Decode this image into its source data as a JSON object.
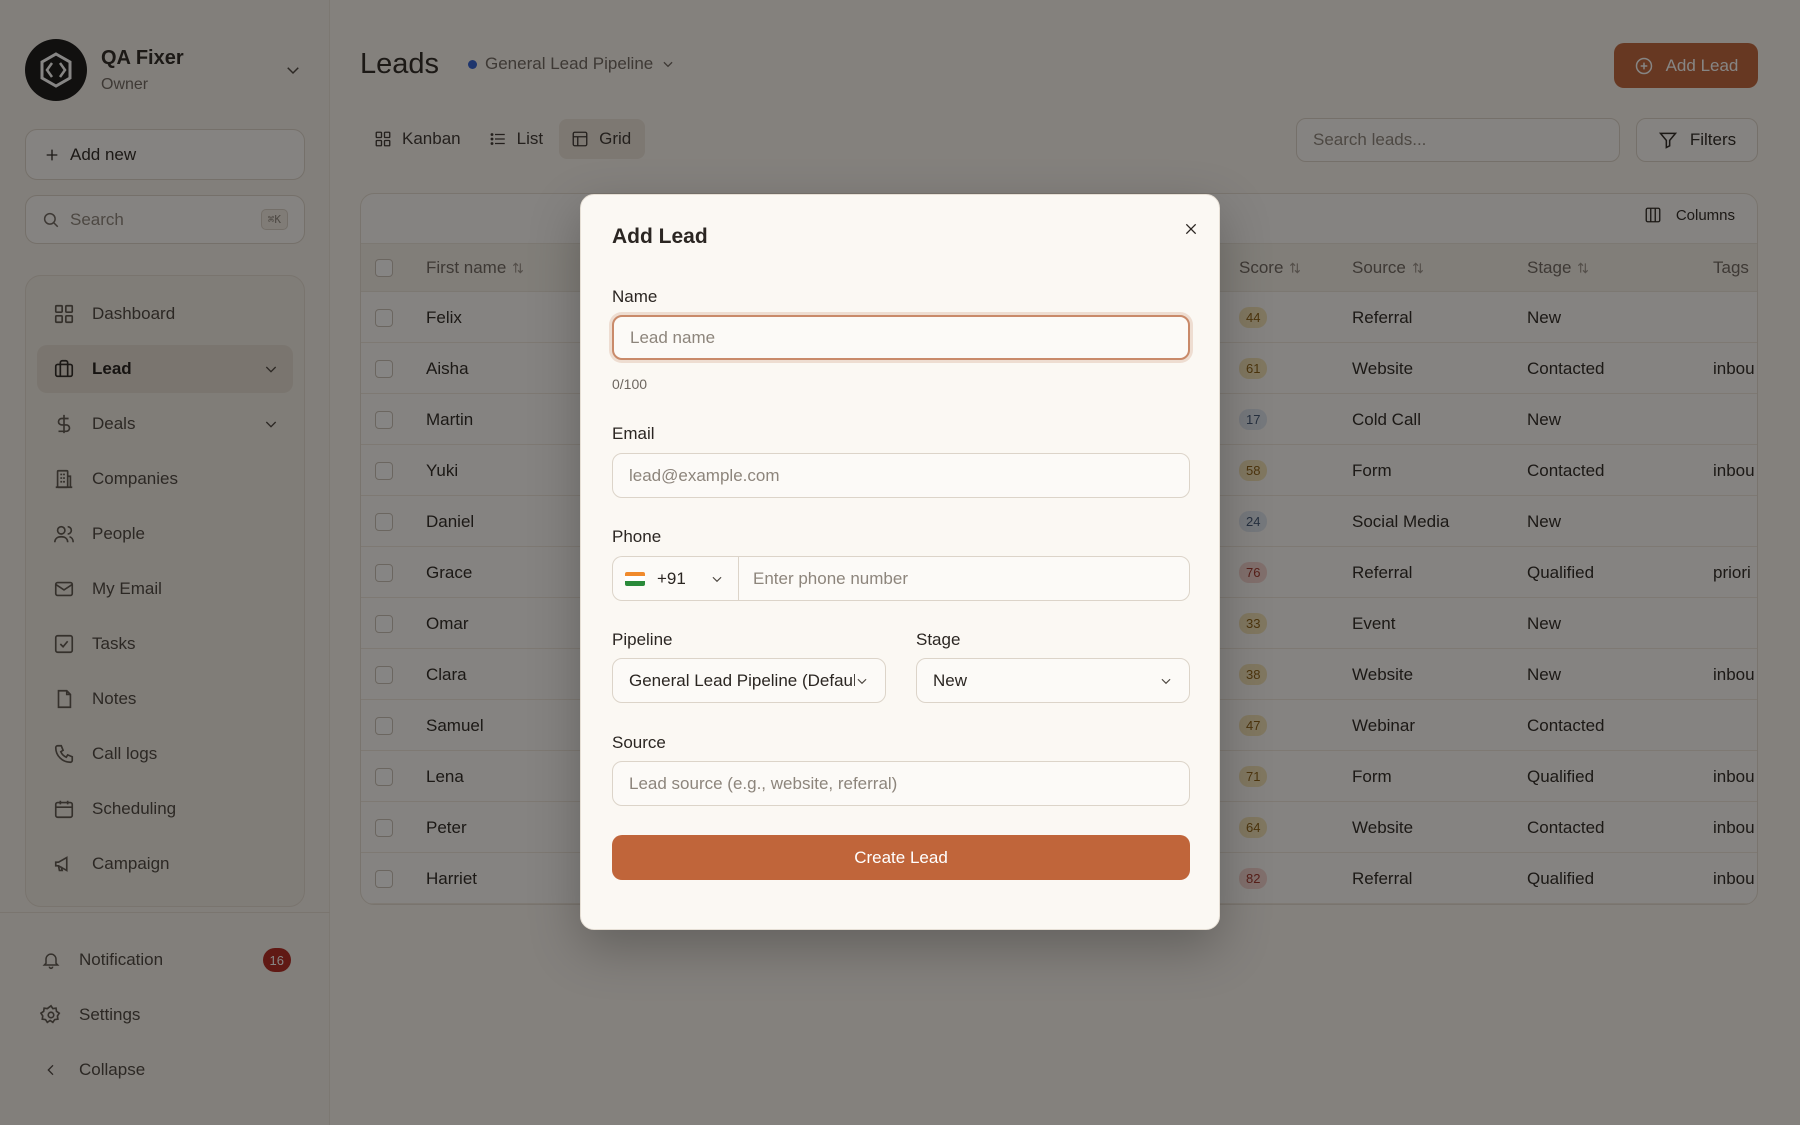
{
  "org": {
    "name": "QA Fixer",
    "role": "Owner"
  },
  "sidebar": {
    "add_new_label": "Add new",
    "search_label": "Search",
    "search_shortcut": "⌘K",
    "items": [
      {
        "label": "Dashboard",
        "icon": "dashboard-icon"
      },
      {
        "label": "Lead",
        "icon": "briefcase-icon",
        "active": true
      },
      {
        "label": "Deals",
        "icon": "dollar-icon"
      },
      {
        "label": "Companies",
        "icon": "building-icon"
      },
      {
        "label": "People",
        "icon": "people-icon"
      },
      {
        "label": "My Email",
        "icon": "mail-icon"
      },
      {
        "label": "Tasks",
        "icon": "task-icon"
      },
      {
        "label": "Notes",
        "icon": "note-icon"
      },
      {
        "label": "Call logs",
        "icon": "phone-icon"
      },
      {
        "label": "Scheduling",
        "icon": "calendar-icon"
      },
      {
        "label": "Campaign",
        "icon": "megaphone-icon"
      }
    ],
    "footer": {
      "notification_label": "Notification",
      "notification_count": "16",
      "settings_label": "Settings",
      "collapse_label": "Collapse"
    }
  },
  "header": {
    "title": "Leads",
    "pipeline": "General Lead Pipeline",
    "add_lead_label": "Add Lead"
  },
  "view_tabs": [
    {
      "label": "Kanban"
    },
    {
      "label": "List"
    },
    {
      "label": "Grid",
      "active": true
    }
  ],
  "toolbar": {
    "search_placeholder": "Search leads...",
    "filters_label": "Filters",
    "columns_label": "Columns"
  },
  "table": {
    "headers": {
      "first_name": "First name",
      "score": "Score",
      "source": "Source",
      "stage": "Stage",
      "tags": "Tags"
    },
    "rows": [
      {
        "first_name": "Felix",
        "score": "44",
        "score_tone": "y",
        "source": "Referral",
        "stage": "New",
        "tags": ""
      },
      {
        "first_name": "Aisha",
        "score": "61",
        "score_tone": "y",
        "source": "Website",
        "stage": "Contacted",
        "tags": "inbou"
      },
      {
        "first_name": "Martin",
        "score": "17",
        "score_tone": "b",
        "source": "Cold Call",
        "stage": "New",
        "tags": ""
      },
      {
        "first_name": "Yuki",
        "score": "58",
        "score_tone": "y",
        "source": "Form",
        "stage": "Contacted",
        "tags": "inbou"
      },
      {
        "first_name": "Daniel",
        "score": "24",
        "score_tone": "b",
        "source": "Social Media",
        "stage": "New",
        "tags": ""
      },
      {
        "first_name": "Grace",
        "score": "76",
        "score_tone": "r",
        "source": "Referral",
        "stage": "Qualified",
        "tags": "priori"
      },
      {
        "first_name": "Omar",
        "score": "33",
        "score_tone": "y",
        "source": "Event",
        "stage": "New",
        "tags": ""
      },
      {
        "first_name": "Clara",
        "score": "38",
        "score_tone": "y",
        "source": "Website",
        "stage": "New",
        "tags": "inbou"
      },
      {
        "first_name": "Samuel",
        "score": "47",
        "score_tone": "y",
        "source": "Webinar",
        "stage": "Contacted",
        "tags": ""
      },
      {
        "first_name": "Lena",
        "score": "71",
        "score_tone": "y",
        "source": "Form",
        "stage": "Qualified",
        "tags": "inbou"
      },
      {
        "first_name": "Peter",
        "score": "64",
        "score_tone": "y",
        "source": "Website",
        "stage": "Contacted",
        "tags": "inbou"
      },
      {
        "first_name": "Harriet",
        "score": "82",
        "score_tone": "r",
        "source": "Referral",
        "stage": "Qualified",
        "tags": "inbou"
      }
    ]
  },
  "modal": {
    "title": "Add Lead",
    "name_label": "Name",
    "name_placeholder": "Lead name",
    "name_counter": "0/100",
    "email_label": "Email",
    "email_placeholder": "lead@example.com",
    "phone_label": "Phone",
    "phone_code": "+91",
    "phone_placeholder": "Enter phone number",
    "pipeline_label": "Pipeline",
    "pipeline_value": "General Lead Pipeline (Default)",
    "stage_label": "Stage",
    "stage_value": "New",
    "source_label": "Source",
    "source_placeholder": "Lead source (e.g., website, referral)",
    "submit_label": "Create Lead"
  },
  "colors": {
    "accent": "#c0653a",
    "notification_badge": "#b3261e",
    "pipeline_dot": "#2f5fd0"
  }
}
